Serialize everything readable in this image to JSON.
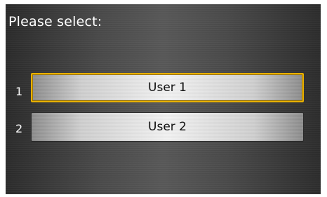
{
  "screen": {
    "title": "Please select:"
  },
  "options": [
    {
      "number": "1",
      "label": "User 1",
      "selected": true
    },
    {
      "number": "2",
      "label": "User 2",
      "selected": false
    }
  ],
  "colors": {
    "highlight": "#e8b000",
    "text": "#ffffff"
  }
}
